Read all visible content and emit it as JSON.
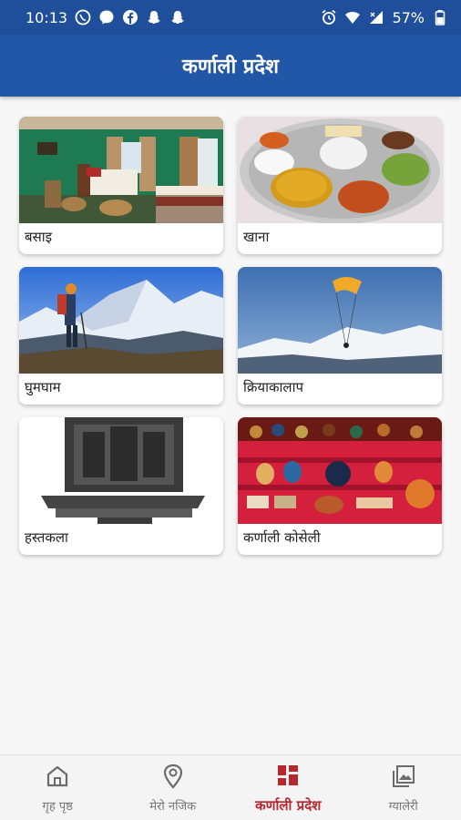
{
  "status_bar": {
    "time": "10:13",
    "battery": "57%",
    "left_icons": [
      "viber-icon",
      "messenger-icon",
      "facebook-icon",
      "snapchat-icon",
      "snapchat-icon"
    ],
    "right_icons": [
      "alarm-icon",
      "wifi-icon",
      "signal-icon",
      "battery-icon"
    ]
  },
  "app_bar": {
    "title": "कर्णाली प्रदेश"
  },
  "cards": [
    {
      "label": "बसाइ",
      "image": "hotel-room"
    },
    {
      "label": "खाना",
      "image": "food-thali"
    },
    {
      "label": "घुमघाम",
      "image": "mountain-trekker"
    },
    {
      "label": "क्रियाकालाप",
      "image": "paragliding"
    },
    {
      "label": "हस्तकला",
      "image": "wood-carving"
    },
    {
      "label": "कर्णाली कोसेली",
      "image": "handicraft-souvenirs"
    }
  ],
  "bottom_nav": {
    "items": [
      {
        "label": "गृह पृष्ठ",
        "icon": "home-icon",
        "active": false
      },
      {
        "label": "मेरो नजिक",
        "icon": "location-pin-icon",
        "active": false
      },
      {
        "label": "कर्णाली प्रदेश",
        "icon": "grid-icon",
        "active": true
      },
      {
        "label": "ग्यालेरी",
        "icon": "gallery-icon",
        "active": false
      }
    ]
  },
  "colors": {
    "primary": "#2157a6",
    "status_bar": "#1f4f9a",
    "active_nav": "#b7282e"
  }
}
